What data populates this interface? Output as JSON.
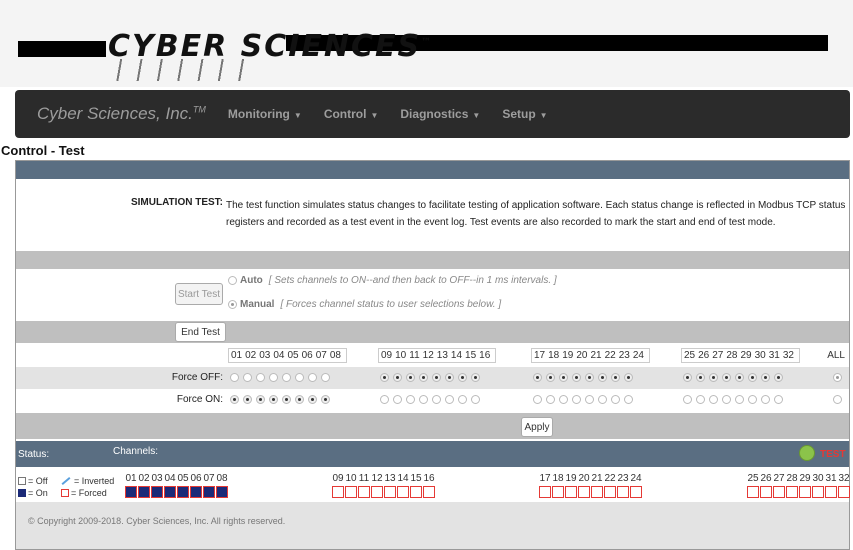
{
  "logo": {
    "text": "CYBER SCIENCES",
    "tm": "™"
  },
  "nav": {
    "brand": "Cyber Sciences, Inc.",
    "brand_tm": "TM",
    "items": [
      "Monitoring",
      "Control",
      "Diagnostics",
      "Setup"
    ]
  },
  "page_title": "Control - Test",
  "simulation": {
    "label": "SIMULATION TEST:",
    "text": "The test function simulates status changes to facilitate testing of application software. Each status change is reflected in Modbus TCP status registers and recorded as a test event in the event log. Test events are also recorded to mark the start and end of test mode."
  },
  "test": {
    "start_label": "Start Test",
    "end_label": "End Test",
    "auto_label": "Auto",
    "auto_desc": "[ Sets channels to ON--and then back to OFF--in 1 ms intervals. ]",
    "manual_label": "Manual",
    "manual_desc": "[ Forces channel status to user selections below. ]"
  },
  "channels": {
    "groups": [
      [
        "01",
        "02",
        "03",
        "04",
        "05",
        "06",
        "07",
        "08"
      ],
      [
        "09",
        "10",
        "11",
        "12",
        "13",
        "14",
        "15",
        "16"
      ],
      [
        "17",
        "18",
        "19",
        "20",
        "21",
        "22",
        "23",
        "24"
      ],
      [
        "25",
        "26",
        "27",
        "28",
        "29",
        "30",
        "31",
        "32"
      ]
    ],
    "all_label": "ALL",
    "force_off_label": "Force OFF:",
    "force_on_label": "Force ON:",
    "force_off_selected": [
      false,
      true,
      true,
      true
    ],
    "apply_label": "Apply"
  },
  "status": {
    "label": "Status:",
    "channels_label": "Channels:",
    "test_label": "TEST",
    "legend": {
      "off": "= Off",
      "on": "= On",
      "inverted": "= Inverted",
      "forced": "= Forced"
    },
    "group_on": [
      true,
      false,
      false,
      false
    ]
  },
  "footer": {
    "copyright": "© Copyright 2009-2018. Cyber Sciences, Inc.  All rights reserved."
  },
  "colors": {
    "navbar": "#2b2b2b",
    "section_bar": "#5a6e82",
    "on": "#1b2a78",
    "forced": "#e53935",
    "status_ok": "#8bc34a"
  }
}
